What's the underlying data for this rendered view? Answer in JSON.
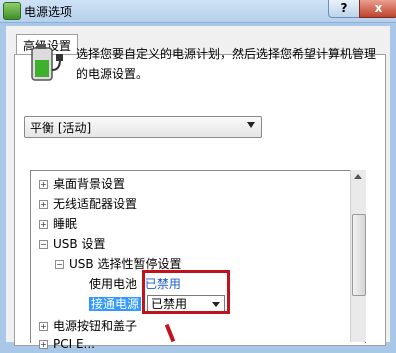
{
  "window": {
    "title": "电源选项",
    "help_label": "?",
    "close_label": "x"
  },
  "dialog": {
    "tab_label": "高级设置",
    "description": "选择您要自定义的电源计划，然后选择您希望计算机管理的电源设置。",
    "plan_select_value": "平衡 [活动]"
  },
  "tree": {
    "desktop_bg": "桌面背景设置",
    "wireless": "无线适配器设置",
    "sleep": "睡眠",
    "usb": "USB 设置",
    "usb_suspend": "USB 选择性暂停设置",
    "on_battery_label": "使用电池",
    "on_battery_value": "已禁用",
    "plugged_in_label": "接通电源",
    "plugged_in_value": "已禁用",
    "power_buttons": "电源按钮和盖子",
    "pci_partial": "PCI E..."
  },
  "colors": {
    "highlight": "#3399ff",
    "value_blue": "#1a5cc8",
    "annotation_red": "#c1121f"
  },
  "icons": {
    "app": "battery-plug-icon",
    "plan": "battery-plug-icon"
  }
}
